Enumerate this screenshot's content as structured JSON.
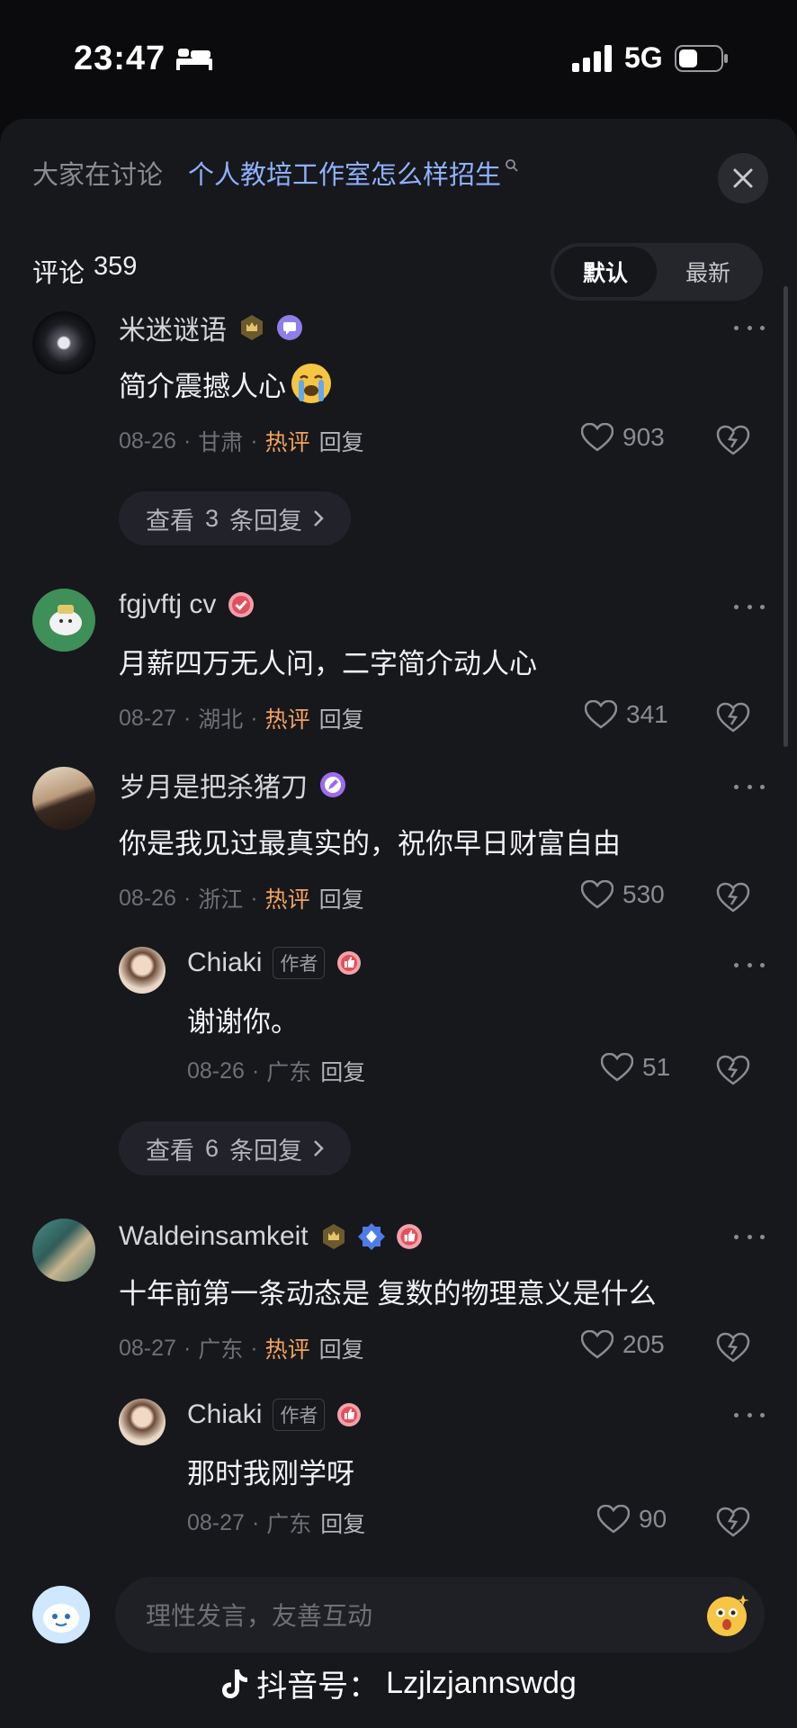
{
  "status_bar": {
    "time": "23:47",
    "network": "5G"
  },
  "discuss": {
    "label": "大家在讨论",
    "topic": "个人教培工作室怎么样招生"
  },
  "header": {
    "comment_label": "评论",
    "comment_count": "359"
  },
  "sort": {
    "options": [
      "默认",
      "最新"
    ],
    "active": "默认"
  },
  "colors": {
    "hot": "#f3a35d",
    "topic": "#8fb1ff",
    "background": "#17181c"
  },
  "comments": [
    {
      "name": "米迷谜语",
      "text": "简介震撼人心",
      "emoji": "😭",
      "date": "08-26",
      "region": "甘肃",
      "hot": "热评",
      "reply": "回复",
      "likes": "903",
      "badges": [
        "crown-badge-icon",
        "chat-badge-icon"
      ]
    },
    {
      "name": "fgjvftj cv",
      "text": "月薪四万无人问，二字简介动人心",
      "date": "08-27",
      "region": "湖北",
      "hot": "热评",
      "reply": "回复",
      "likes": "341",
      "badges": [
        "check-badge-icon"
      ]
    },
    {
      "name": "岁月是把杀猪刀",
      "text": "你是我见过最真实的，祝你早日财富自由",
      "date": "08-26",
      "region": "浙江",
      "hot": "热评",
      "reply": "回复",
      "likes": "530",
      "badges": [
        "pen-badge-icon"
      ]
    },
    {
      "name": "Chiaki",
      "author_tag": "作者",
      "text": "谢谢你。",
      "date": "08-26",
      "region": "广东",
      "reply": "回复",
      "likes": "51",
      "badges": [
        "thumb-badge-icon"
      ]
    },
    {
      "name": "Waldeinsamkeit",
      "text": "十年前第一条动态是 复数的物理意义是什么",
      "date": "08-27",
      "region": "广东",
      "hot": "热评",
      "reply": "回复",
      "likes": "205",
      "badges": [
        "crown-badge-icon",
        "diamond-badge-icon",
        "thumb-badge-icon"
      ]
    },
    {
      "name": "Chiaki",
      "author_tag": "作者",
      "text": "那时我刚学呀",
      "date": "08-27",
      "region": "广东",
      "reply": "回复",
      "likes": "90",
      "badges": [
        "thumb-badge-icon"
      ]
    }
  ],
  "view_replies": [
    {
      "prefix": "查看",
      "count": "3",
      "suffix": "条回复"
    },
    {
      "prefix": "查看",
      "count": "6",
      "suffix": "条回复"
    }
  ],
  "input": {
    "placeholder": "理性发言，友善互动"
  },
  "watermark": {
    "label": "抖音号：",
    "id": "Lzjlzjannswdg"
  }
}
